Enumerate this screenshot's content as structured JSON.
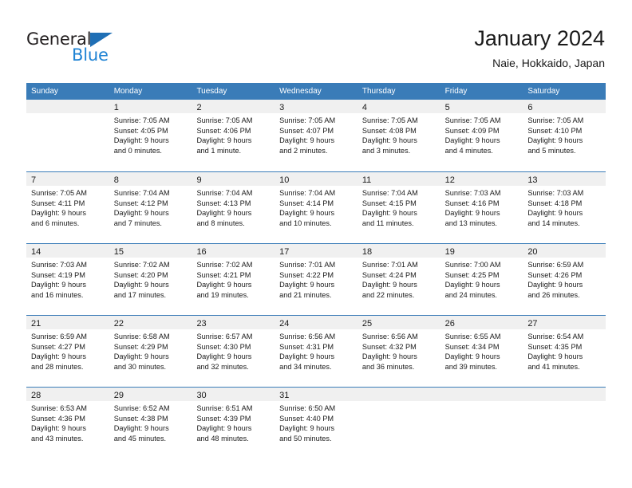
{
  "brand": {
    "name_part1": "General",
    "name_part2": "Blue",
    "triangle_color": "#1f6fb5",
    "blue_color": "#1f83d4"
  },
  "header": {
    "title": "January 2024",
    "subtitle": "Naie, Hokkaido, Japan"
  },
  "theme": {
    "header_band": "#3a7cb8",
    "daynum_band": "#f0f0f0",
    "text": "#1a1a1a"
  },
  "weekdays": [
    "Sunday",
    "Monday",
    "Tuesday",
    "Wednesday",
    "Thursday",
    "Friday",
    "Saturday"
  ],
  "weeks": [
    [
      {
        "day": "",
        "lines": []
      },
      {
        "day": "1",
        "lines": [
          "Sunrise: 7:05 AM",
          "Sunset: 4:05 PM",
          "Daylight: 9 hours",
          "and 0 minutes."
        ]
      },
      {
        "day": "2",
        "lines": [
          "Sunrise: 7:05 AM",
          "Sunset: 4:06 PM",
          "Daylight: 9 hours",
          "and 1 minute."
        ]
      },
      {
        "day": "3",
        "lines": [
          "Sunrise: 7:05 AM",
          "Sunset: 4:07 PM",
          "Daylight: 9 hours",
          "and 2 minutes."
        ]
      },
      {
        "day": "4",
        "lines": [
          "Sunrise: 7:05 AM",
          "Sunset: 4:08 PM",
          "Daylight: 9 hours",
          "and 3 minutes."
        ]
      },
      {
        "day": "5",
        "lines": [
          "Sunrise: 7:05 AM",
          "Sunset: 4:09 PM",
          "Daylight: 9 hours",
          "and 4 minutes."
        ]
      },
      {
        "day": "6",
        "lines": [
          "Sunrise: 7:05 AM",
          "Sunset: 4:10 PM",
          "Daylight: 9 hours",
          "and 5 minutes."
        ]
      }
    ],
    [
      {
        "day": "7",
        "lines": [
          "Sunrise: 7:05 AM",
          "Sunset: 4:11 PM",
          "Daylight: 9 hours",
          "and 6 minutes."
        ]
      },
      {
        "day": "8",
        "lines": [
          "Sunrise: 7:04 AM",
          "Sunset: 4:12 PM",
          "Daylight: 9 hours",
          "and 7 minutes."
        ]
      },
      {
        "day": "9",
        "lines": [
          "Sunrise: 7:04 AM",
          "Sunset: 4:13 PM",
          "Daylight: 9 hours",
          "and 8 minutes."
        ]
      },
      {
        "day": "10",
        "lines": [
          "Sunrise: 7:04 AM",
          "Sunset: 4:14 PM",
          "Daylight: 9 hours",
          "and 10 minutes."
        ]
      },
      {
        "day": "11",
        "lines": [
          "Sunrise: 7:04 AM",
          "Sunset: 4:15 PM",
          "Daylight: 9 hours",
          "and 11 minutes."
        ]
      },
      {
        "day": "12",
        "lines": [
          "Sunrise: 7:03 AM",
          "Sunset: 4:16 PM",
          "Daylight: 9 hours",
          "and 13 minutes."
        ]
      },
      {
        "day": "13",
        "lines": [
          "Sunrise: 7:03 AM",
          "Sunset: 4:18 PM",
          "Daylight: 9 hours",
          "and 14 minutes."
        ]
      }
    ],
    [
      {
        "day": "14",
        "lines": [
          "Sunrise: 7:03 AM",
          "Sunset: 4:19 PM",
          "Daylight: 9 hours",
          "and 16 minutes."
        ]
      },
      {
        "day": "15",
        "lines": [
          "Sunrise: 7:02 AM",
          "Sunset: 4:20 PM",
          "Daylight: 9 hours",
          "and 17 minutes."
        ]
      },
      {
        "day": "16",
        "lines": [
          "Sunrise: 7:02 AM",
          "Sunset: 4:21 PM",
          "Daylight: 9 hours",
          "and 19 minutes."
        ]
      },
      {
        "day": "17",
        "lines": [
          "Sunrise: 7:01 AM",
          "Sunset: 4:22 PM",
          "Daylight: 9 hours",
          "and 21 minutes."
        ]
      },
      {
        "day": "18",
        "lines": [
          "Sunrise: 7:01 AM",
          "Sunset: 4:24 PM",
          "Daylight: 9 hours",
          "and 22 minutes."
        ]
      },
      {
        "day": "19",
        "lines": [
          "Sunrise: 7:00 AM",
          "Sunset: 4:25 PM",
          "Daylight: 9 hours",
          "and 24 minutes."
        ]
      },
      {
        "day": "20",
        "lines": [
          "Sunrise: 6:59 AM",
          "Sunset: 4:26 PM",
          "Daylight: 9 hours",
          "and 26 minutes."
        ]
      }
    ],
    [
      {
        "day": "21",
        "lines": [
          "Sunrise: 6:59 AM",
          "Sunset: 4:27 PM",
          "Daylight: 9 hours",
          "and 28 minutes."
        ]
      },
      {
        "day": "22",
        "lines": [
          "Sunrise: 6:58 AM",
          "Sunset: 4:29 PM",
          "Daylight: 9 hours",
          "and 30 minutes."
        ]
      },
      {
        "day": "23",
        "lines": [
          "Sunrise: 6:57 AM",
          "Sunset: 4:30 PM",
          "Daylight: 9 hours",
          "and 32 minutes."
        ]
      },
      {
        "day": "24",
        "lines": [
          "Sunrise: 6:56 AM",
          "Sunset: 4:31 PM",
          "Daylight: 9 hours",
          "and 34 minutes."
        ]
      },
      {
        "day": "25",
        "lines": [
          "Sunrise: 6:56 AM",
          "Sunset: 4:32 PM",
          "Daylight: 9 hours",
          "and 36 minutes."
        ]
      },
      {
        "day": "26",
        "lines": [
          "Sunrise: 6:55 AM",
          "Sunset: 4:34 PM",
          "Daylight: 9 hours",
          "and 39 minutes."
        ]
      },
      {
        "day": "27",
        "lines": [
          "Sunrise: 6:54 AM",
          "Sunset: 4:35 PM",
          "Daylight: 9 hours",
          "and 41 minutes."
        ]
      }
    ],
    [
      {
        "day": "28",
        "lines": [
          "Sunrise: 6:53 AM",
          "Sunset: 4:36 PM",
          "Daylight: 9 hours",
          "and 43 minutes."
        ]
      },
      {
        "day": "29",
        "lines": [
          "Sunrise: 6:52 AM",
          "Sunset: 4:38 PM",
          "Daylight: 9 hours",
          "and 45 minutes."
        ]
      },
      {
        "day": "30",
        "lines": [
          "Sunrise: 6:51 AM",
          "Sunset: 4:39 PM",
          "Daylight: 9 hours",
          "and 48 minutes."
        ]
      },
      {
        "day": "31",
        "lines": [
          "Sunrise: 6:50 AM",
          "Sunset: 4:40 PM",
          "Daylight: 9 hours",
          "and 50 minutes."
        ]
      },
      {
        "day": "",
        "lines": []
      },
      {
        "day": "",
        "lines": []
      },
      {
        "day": "",
        "lines": []
      }
    ]
  ]
}
